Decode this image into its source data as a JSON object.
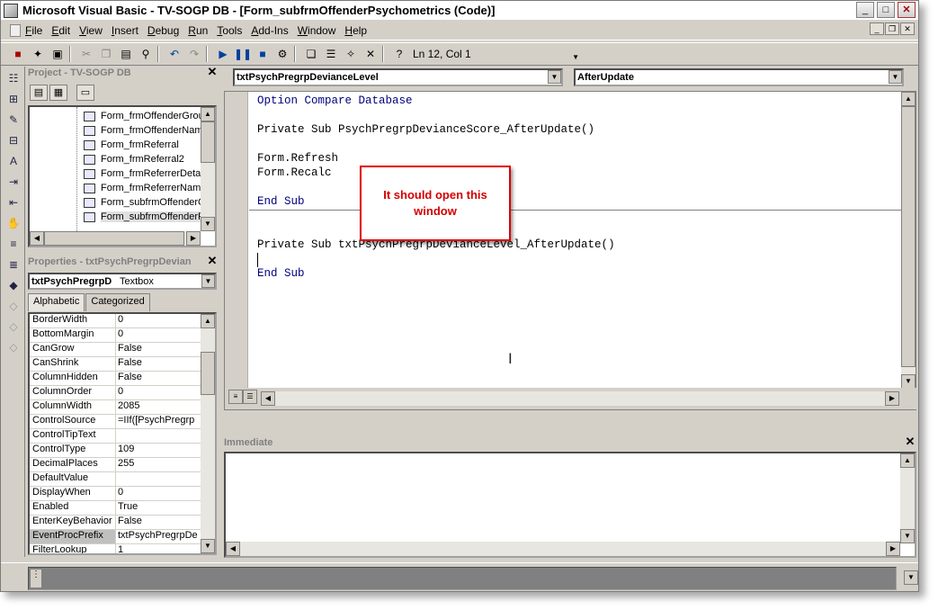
{
  "window": {
    "title": "Microsoft Visual Basic - TV-SOGP DB - [Form_subfrmOffenderPsychometrics (Code)]",
    "controls": {
      "minimize": "_",
      "maximize": "□",
      "close": "✕"
    }
  },
  "menu": {
    "items": [
      "File",
      "Edit",
      "View",
      "Insert",
      "Debug",
      "Run",
      "Tools",
      "Add-Ins",
      "Window",
      "Help"
    ],
    "mdi_controls": {
      "minimize": "_",
      "restore": "❐",
      "close": "✕"
    }
  },
  "toolbar": {
    "icons": [
      "access-icon",
      "insert-module-icon",
      "save-icon",
      "cut-icon",
      "copy-icon",
      "paste-icon",
      "find-icon",
      "undo-icon",
      "redo-icon",
      "run-icon",
      "break-icon",
      "reset-icon",
      "design-mode-icon",
      "project-explorer-icon",
      "properties-icon",
      "object-browser-icon",
      "toolbox-icon",
      "help-icon"
    ],
    "cursor_position": "Ln 12, Col 1"
  },
  "project_pane": {
    "title": "Project - TV-SOGP DB",
    "close": "✕",
    "items": [
      "Form_frmOffenderGroup",
      "Form_frmOffenderName",
      "Form_frmReferral",
      "Form_frmReferral2",
      "Form_frmReferrerDetail",
      "Form_frmReferrerName",
      "Form_subfrmOffenderG",
      "Form_subfrmOffenderPs"
    ],
    "selected_index": 7
  },
  "properties_pane": {
    "title": "Properties - txtPsychPregrpDevian",
    "close": "✕",
    "object_name": "txtPsychPregrpD",
    "object_type": "Textbox",
    "tabs": [
      "Alphabetic",
      "Categorized"
    ],
    "active_tab": "Alphabetic",
    "rows": [
      {
        "name": "BorderWidth",
        "value": "0"
      },
      {
        "name": "BottomMargin",
        "value": "0"
      },
      {
        "name": "CanGrow",
        "value": "False"
      },
      {
        "name": "CanShrink",
        "value": "False"
      },
      {
        "name": "ColumnHidden",
        "value": "False"
      },
      {
        "name": "ColumnOrder",
        "value": "0"
      },
      {
        "name": "ColumnWidth",
        "value": "2085"
      },
      {
        "name": "ControlSource",
        "value": "=IIf([PsychPregrp"
      },
      {
        "name": "ControlTipText",
        "value": ""
      },
      {
        "name": "ControlType",
        "value": "109"
      },
      {
        "name": "DecimalPlaces",
        "value": "255"
      },
      {
        "name": "DefaultValue",
        "value": ""
      },
      {
        "name": "DisplayWhen",
        "value": "0"
      },
      {
        "name": "Enabled",
        "value": "True"
      },
      {
        "name": "EnterKeyBehavior",
        "value": "False"
      },
      {
        "name": "EventProcPrefix",
        "value": "txtPsychPregrpDe"
      },
      {
        "name": "FilterLookup",
        "value": "1"
      }
    ],
    "selected_row": 15
  },
  "code_window": {
    "object_combo": "txtPsychPregrpDevianceLevel",
    "procedure_combo": "AfterUpdate",
    "lines": [
      "Option Compare Database",
      "",
      "Private Sub PsychPregrpDevianceScore_AfterUpdate()",
      "",
      "Form.Refresh",
      "Form.Recalc",
      "",
      "End Sub",
      "",
      "",
      "Private Sub txtPsychPregrpDevianceLevel_AfterUpdate()",
      "",
      "End Sub"
    ],
    "annotation": "It should open this window"
  },
  "immediate_pane": {
    "title": "Immediate",
    "close": "✕"
  },
  "colors": {
    "chrome": "#d4d0c8",
    "annotation_border": "#e00000",
    "annotation_text": "#d40000",
    "keyword": "#00007f"
  }
}
